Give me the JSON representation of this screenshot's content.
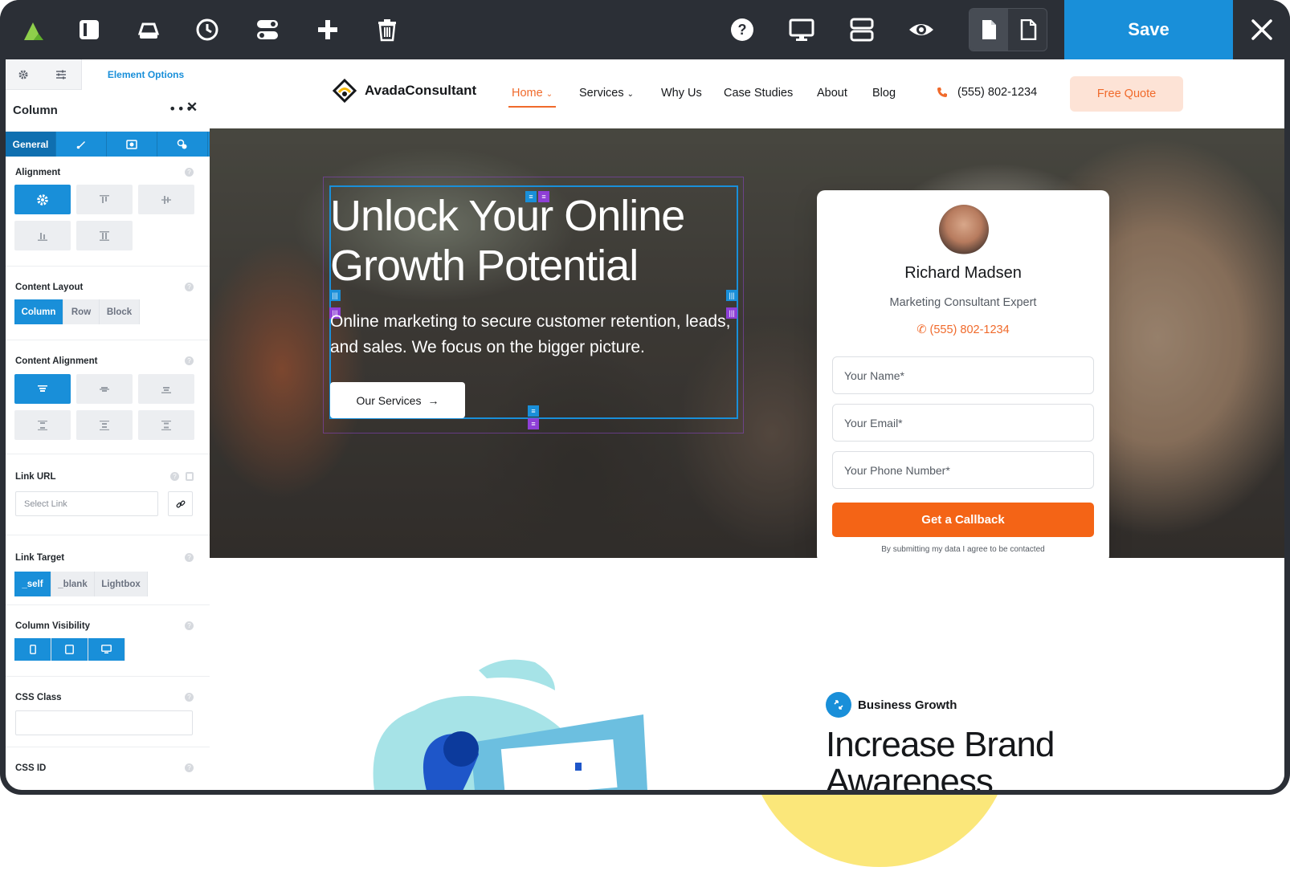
{
  "toolbar": {
    "icons": [
      "avada-logo-icon",
      "sidebar-toggle-icon",
      "library-icon",
      "history-icon",
      "toggle-icon",
      "add-icon",
      "trash-icon",
      "help-icon",
      "desktop-icon",
      "layout-icon",
      "preview-icon",
      "page-icon",
      "page-alt-icon",
      "close-icon"
    ],
    "save_label": "Save",
    "accent": "#198fd9"
  },
  "panel": {
    "tab_label": "Element Options",
    "title": "Column",
    "subtabs": [
      "General"
    ],
    "alignment_label": "Alignment",
    "content_layout_label": "Content Layout",
    "content_layout_options": [
      "Column",
      "Row",
      "Block"
    ],
    "content_alignment_label": "Content Alignment",
    "link_url_label": "Link URL",
    "link_url_placeholder": "Select Link",
    "link_target_label": "Link Target",
    "link_target_options": [
      "_self",
      "_blank",
      "Lightbox"
    ],
    "column_visibility_label": "Column Visibility",
    "css_class_label": "CSS Class",
    "css_id_label": "CSS ID"
  },
  "site": {
    "logo": "AvadaConsultant",
    "nav": [
      "Home",
      "Services",
      "Why Us",
      "Case Studies",
      "About",
      "Blog"
    ],
    "phone": "(555) 802-1234",
    "quote_label": "Free Quote",
    "accent": "#f06a2b"
  },
  "hero": {
    "title": "Unlock Your Online Growth Potential",
    "subtitle": "Online marketing to secure customer retention, leads, and sales. We focus on the bigger picture.",
    "button_label": "Our Services"
  },
  "card": {
    "name": "Richard Madsen",
    "role": "Marketing Consultant Expert",
    "phone": "(555) 802-1234",
    "name_placeholder": "Your Name*",
    "email_placeholder": "Your Email*",
    "phone_placeholder": "Your Phone Number*",
    "button_label": "Get a Callback",
    "disclaimer": "By submitting my data I agree to be contacted"
  },
  "section2": {
    "badge": "Business Growth",
    "heading": "Increase Brand Awareness"
  }
}
